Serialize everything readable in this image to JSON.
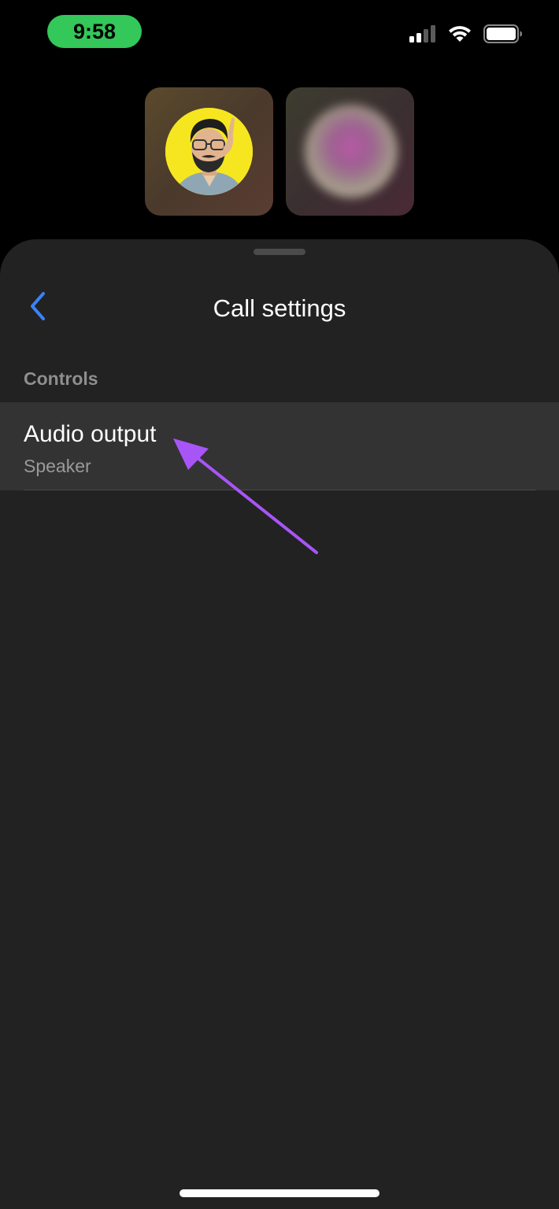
{
  "status_bar": {
    "time": "9:58",
    "time_pill_color": "#34c759",
    "signal_icon": "cellular-signal-icon",
    "wifi_icon": "wifi-icon",
    "battery_icon": "battery-icon"
  },
  "participants": [
    {
      "type": "cartoon-avatar",
      "avatar_bg_color": "#f6e61f"
    },
    {
      "type": "blurred-avatar"
    }
  ],
  "sheet": {
    "title": "Call settings",
    "back_icon": "chevron-left-icon",
    "back_color": "#3a82f7",
    "section": {
      "header": "Controls",
      "items": [
        {
          "label": "Audio output",
          "value": "Speaker"
        }
      ]
    }
  },
  "annotation": {
    "arrow_color": "#a855f7"
  }
}
